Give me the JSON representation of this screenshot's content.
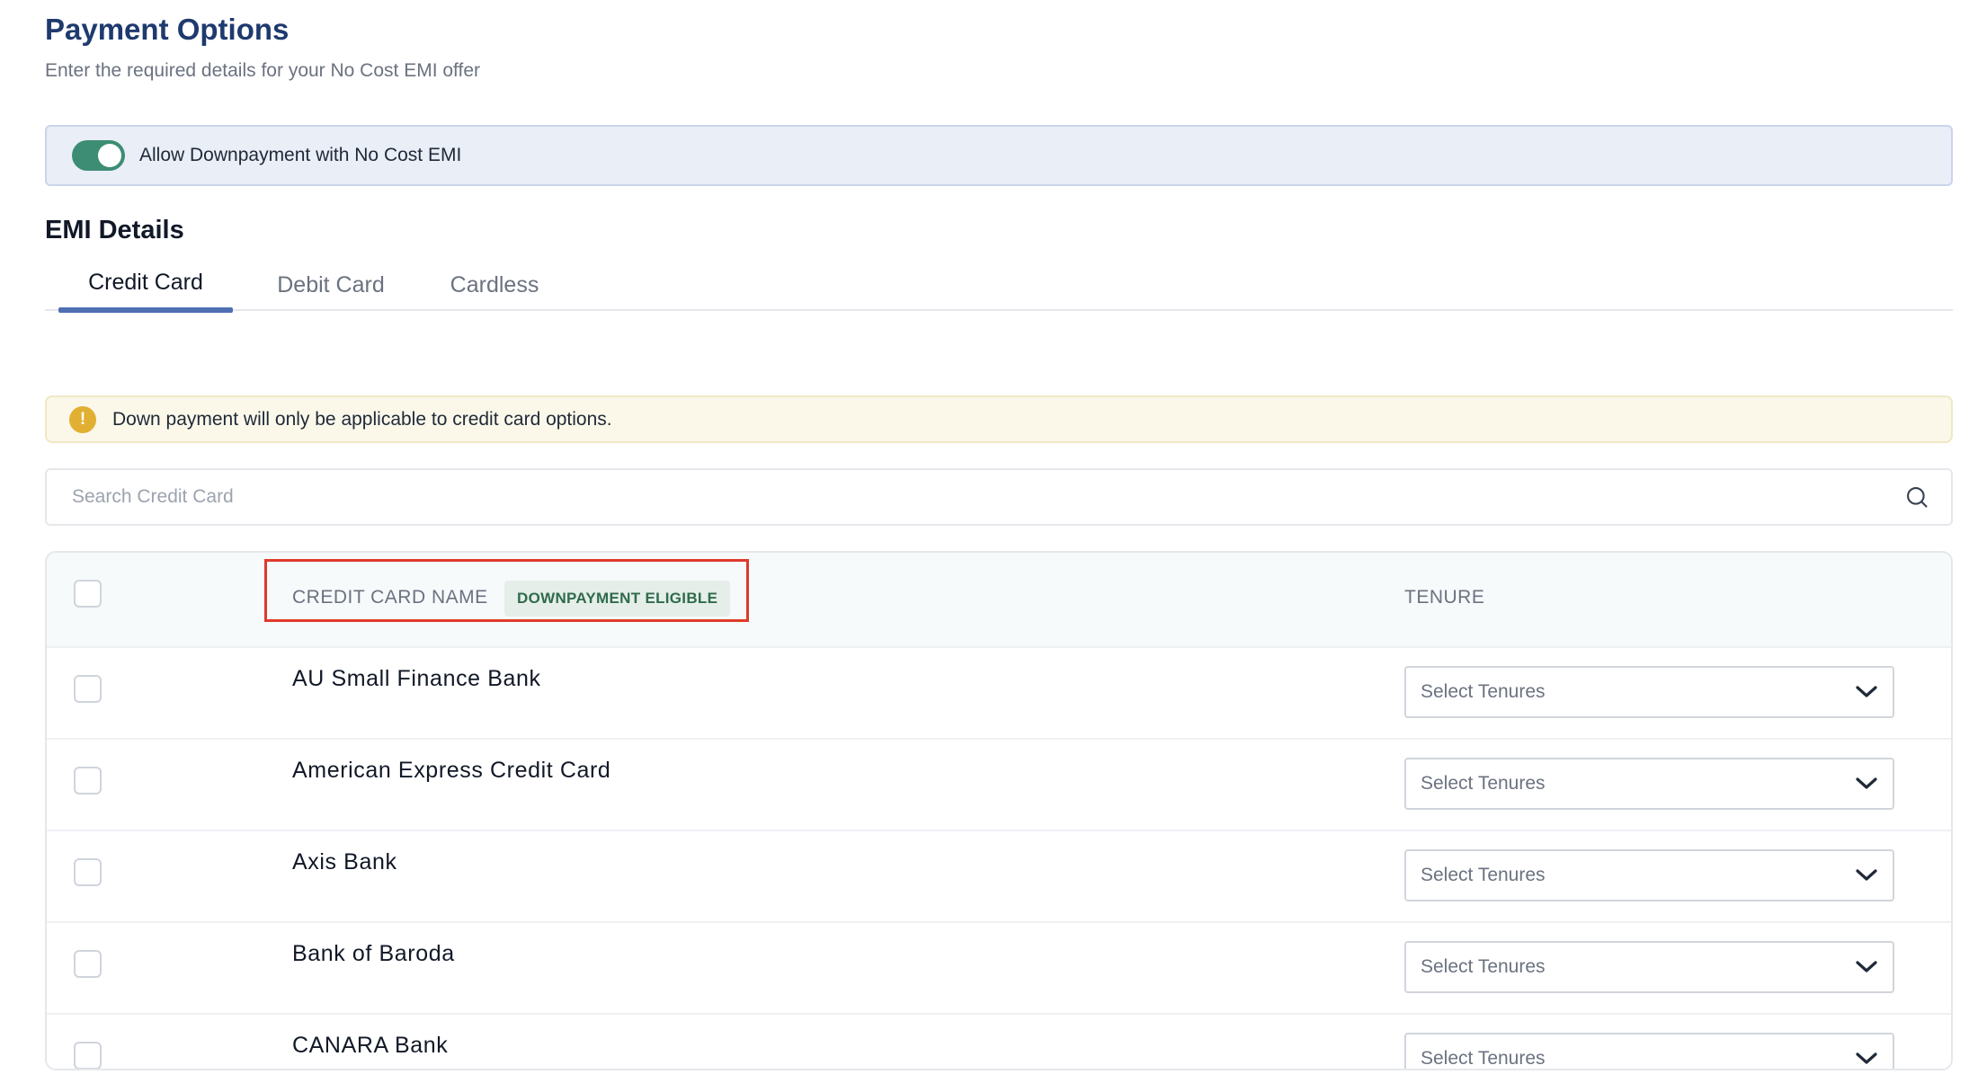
{
  "header": {
    "title": "Payment Options",
    "subtitle": "Enter the required details for your No Cost EMI offer"
  },
  "downpayment_toggle": {
    "label": "Allow Downpayment with No Cost EMI",
    "enabled": true,
    "color": "#3d8d74"
  },
  "emi_details": {
    "title": "EMI Details",
    "tabs": [
      {
        "label": "Credit Card",
        "active": true
      },
      {
        "label": "Debit Card",
        "active": false
      },
      {
        "label": "Cardless",
        "active": false
      }
    ]
  },
  "notice": {
    "icon": "warning-icon",
    "icon_glyph": "!",
    "text": "Down payment will only be applicable to credit card options."
  },
  "search": {
    "placeholder": "Search Credit Card",
    "icon": "search-icon"
  },
  "table": {
    "columns": {
      "name": "CREDIT CARD NAME",
      "badge": "DOWNPAYMENT ELIGIBLE",
      "tenure": "TENURE"
    },
    "rows": [
      {
        "name": "AU Small Finance Bank",
        "tenure_placeholder": "Select Tenures"
      },
      {
        "name": "American Express Credit Card",
        "tenure_placeholder": "Select Tenures"
      },
      {
        "name": "Axis Bank",
        "tenure_placeholder": "Select Tenures"
      },
      {
        "name": "Bank of Baroda",
        "tenure_placeholder": "Select Tenures"
      },
      {
        "name": "CANARA Bank",
        "tenure_placeholder": "Select Tenures"
      }
    ]
  },
  "colors": {
    "title": "#1e3a6e",
    "accent_tab": "#4f6fb3",
    "highlight_border": "#e0392b",
    "warning": "#e1b032"
  }
}
